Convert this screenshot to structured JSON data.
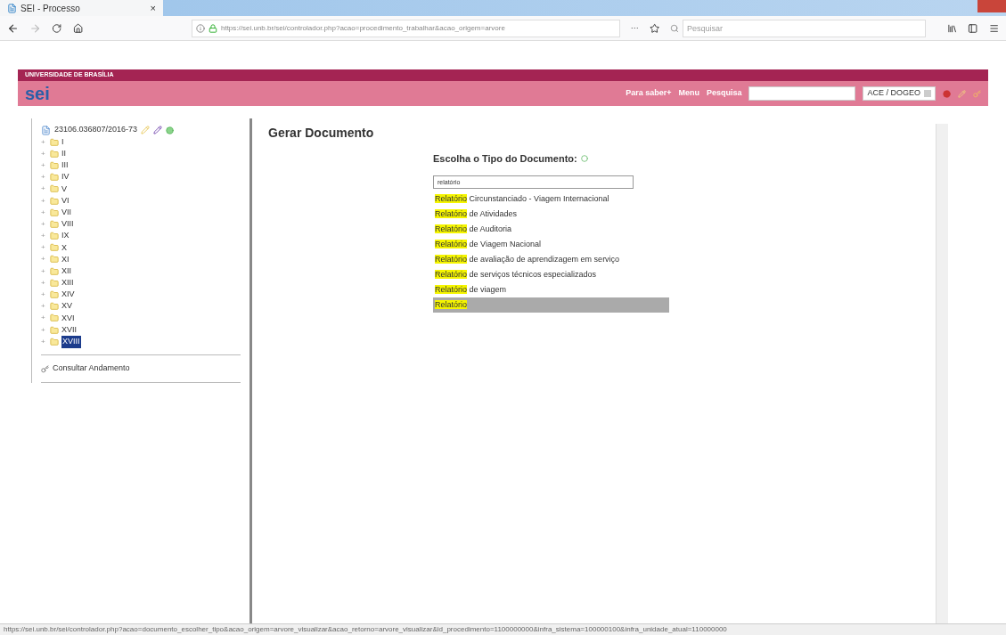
{
  "browser": {
    "tab_title": "SEI - Processo",
    "tab_close": "×",
    "url": "https://sei.unb.br/sei/controlador.php?acao=procedimento_trabalhar&acao_origem=arvore",
    "more": "···",
    "search_placeholder": "Pesquisar",
    "status_url": "https://sei.unb.br/sei/controlador.php?acao=documento_escolher_tipo&acao_origem=arvore_visualizar&acao_retorno=arvore_visualizar&id_procedimento=1100000000&infra_sistema=100000100&infra_unidade_atual=110000000"
  },
  "header": {
    "institution": "UNIVERSIDADE DE BRASÍLIA",
    "logo": "sei",
    "links": [
      "Para saber+",
      "Menu",
      "Pesquisa"
    ],
    "unit": "ACE / DOGEO"
  },
  "tree": {
    "process": "23106.036807/2016-73",
    "folders": [
      {
        "label": "I",
        "selected": false
      },
      {
        "label": "II",
        "selected": false
      },
      {
        "label": "III",
        "selected": false
      },
      {
        "label": "IV",
        "selected": false
      },
      {
        "label": "V",
        "selected": false
      },
      {
        "label": "VI",
        "selected": false
      },
      {
        "label": "VII",
        "selected": false
      },
      {
        "label": "VIII",
        "selected": false
      },
      {
        "label": "IX",
        "selected": false
      },
      {
        "label": "X",
        "selected": false
      },
      {
        "label": "XI",
        "selected": false
      },
      {
        "label": "XII",
        "selected": false
      },
      {
        "label": "XIII",
        "selected": false
      },
      {
        "label": "XIV",
        "selected": false
      },
      {
        "label": "XV",
        "selected": false
      },
      {
        "label": "XVI",
        "selected": false
      },
      {
        "label": "XVII",
        "selected": false
      },
      {
        "label": "XVIII",
        "selected": true
      }
    ],
    "expand_sign": "+",
    "consult": "Consultar Andamento"
  },
  "main": {
    "title": "Gerar Documento",
    "prompt": "Escolha o Tipo do Documento:",
    "filter_value": "relatório",
    "options": [
      {
        "match": "Relatório",
        "rest": " Circunstanciado - Viagem Internacional",
        "selected": false
      },
      {
        "match": "Relatório",
        "rest": " de Atividades",
        "selected": false
      },
      {
        "match": "Relatório",
        "rest": " de Auditoria",
        "selected": false
      },
      {
        "match": "Relatório",
        "rest": " de Viagem Nacional",
        "selected": false
      },
      {
        "match": "Relatório",
        "rest": " de avaliação de aprendizagem em serviço",
        "selected": false
      },
      {
        "match": "Relatório",
        "rest": " de serviços técnicos especializados",
        "selected": false
      },
      {
        "match": "Relatório",
        "rest": " de viagem",
        "selected": false
      },
      {
        "match": "Relatório",
        "selected": true
      }
    ]
  }
}
